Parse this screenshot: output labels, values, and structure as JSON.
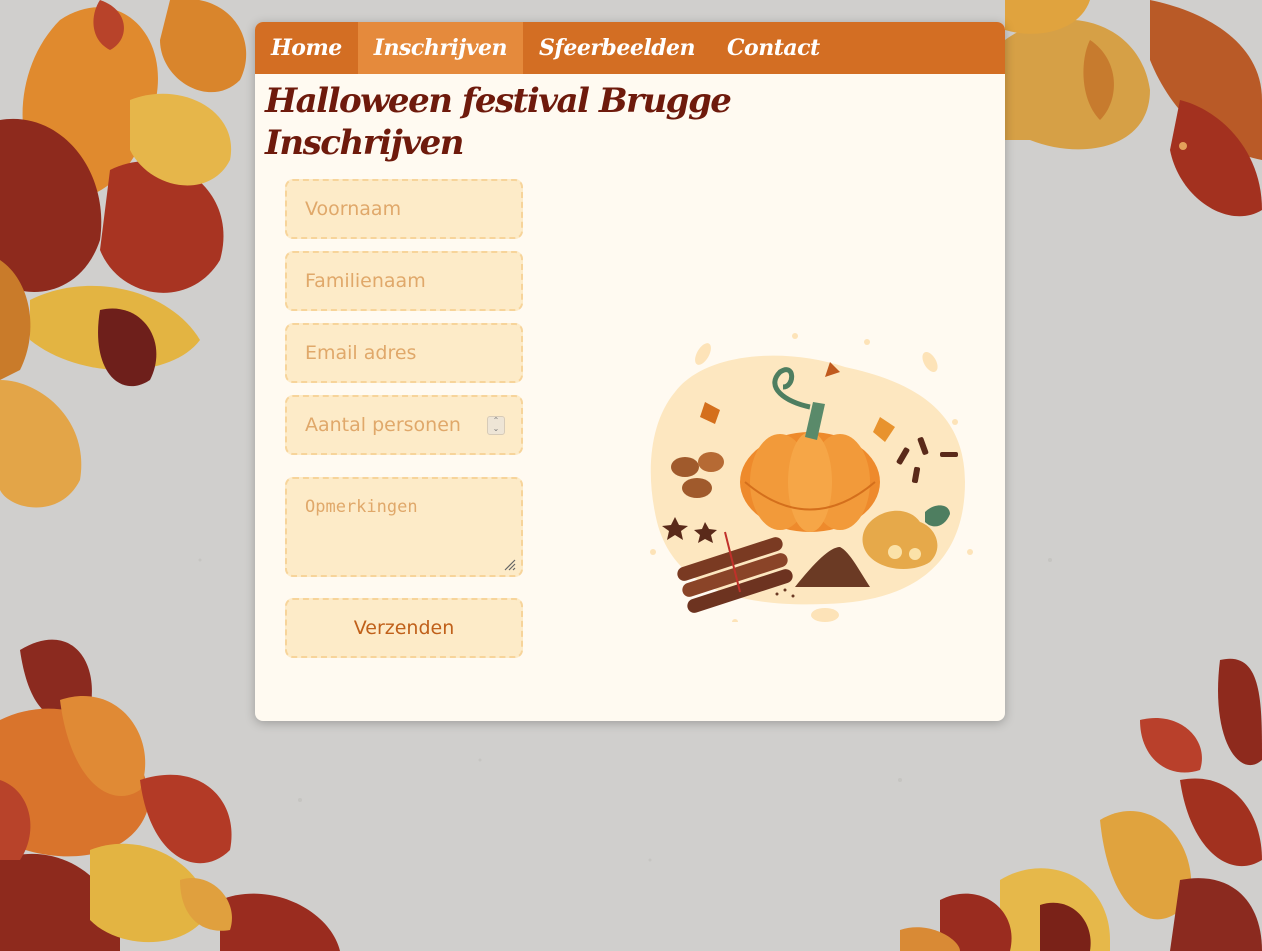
{
  "nav": {
    "items": [
      {
        "label": "Home",
        "active": false
      },
      {
        "label": "Inschrijven",
        "active": true
      },
      {
        "label": "Sfeerbeelden",
        "active": false
      },
      {
        "label": "Contact",
        "active": false
      }
    ]
  },
  "header": {
    "title_line1": "Halloween festival Brugge",
    "title_line2": "Inschrijven"
  },
  "form": {
    "firstname_placeholder": "Voornaam",
    "lastname_placeholder": "Familienaam",
    "email_placeholder": "Email adres",
    "persons_placeholder": "Aantal personen",
    "remarks_placeholder": "Opmerkingen",
    "submit_label": "Verzenden"
  },
  "colors": {
    "nav_bg": "#d36e23",
    "nav_active": "#e58a3c",
    "title": "#6e1a0c",
    "field_bg": "#fdebc8",
    "card_bg": "#fffaf1"
  },
  "icons": {
    "illustration": "pumpkin-spices-illustration",
    "spinner": "number-spinner-icon"
  }
}
